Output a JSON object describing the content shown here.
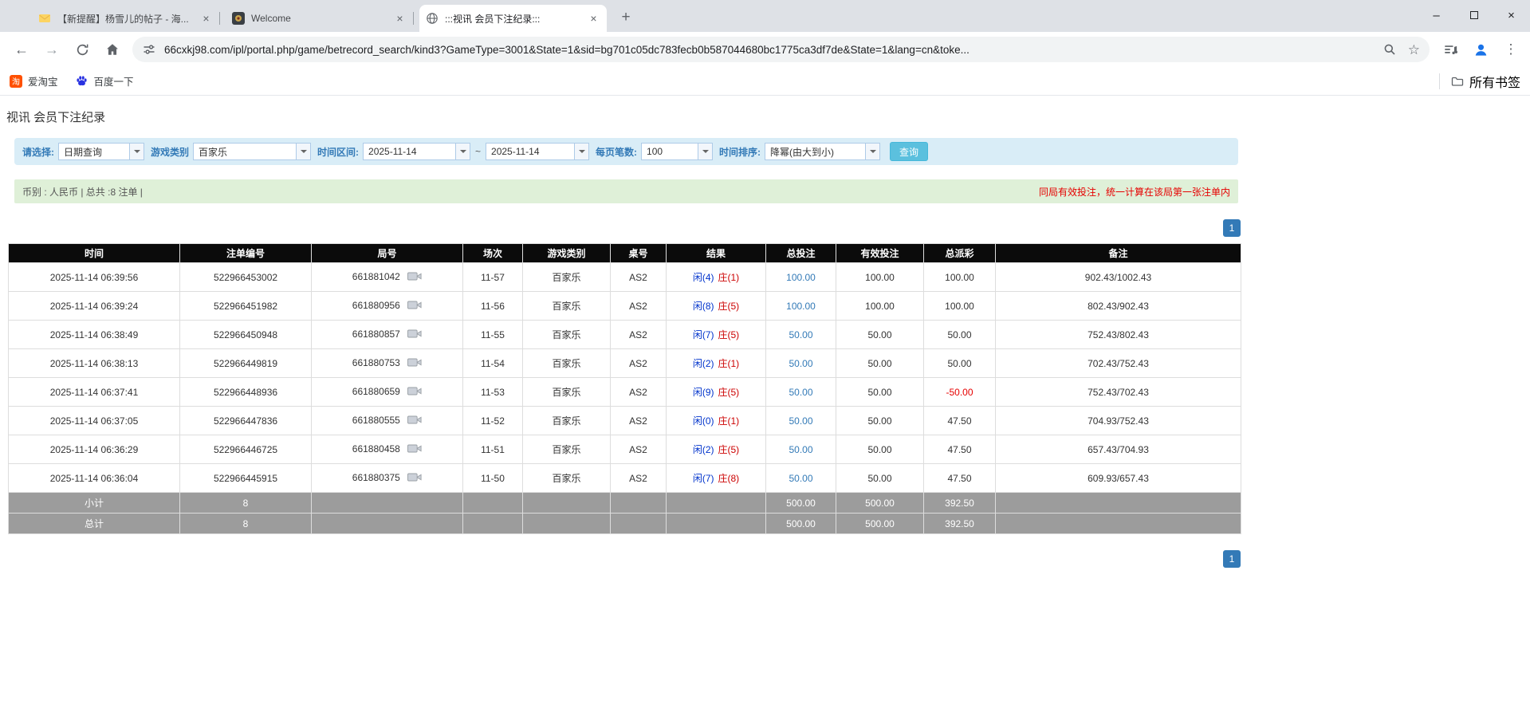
{
  "browser": {
    "tabs": [
      {
        "title": "【新提醒】杨雪儿的帖子 - 海..."
      },
      {
        "title": "Welcome"
      },
      {
        "title": ":::视讯 会员下注纪录:::"
      }
    ],
    "url": "66cxkj98.com/ipl/portal.php/game/betrecord_search/kind3?GameType=3001&State=1&sid=bg701c05dc783fecb0b587044680bc1775ca3df7de&State=1&lang=cn&toke...",
    "glyphs": {
      "back": "←",
      "forward": "→",
      "star": "☆",
      "menu": "⋮",
      "new_tab": "+",
      "close": "×",
      "minimize": "–"
    },
    "bookmarks": {
      "items": [
        {
          "label": "爱淘宝",
          "badge": "淘"
        },
        {
          "label": "百度一下"
        }
      ],
      "all_bookmarks": "所有书签"
    }
  },
  "page": {
    "title": "视讯 会员下注纪录",
    "filters": {
      "select_label": "请选择:",
      "select_value": "日期查询",
      "game_type_label": "游戏类别",
      "game_type_value": "百家乐",
      "range_label": "时间区间:",
      "date_from": "2025-11-14",
      "tilde": "~",
      "date_to": "2025-11-14",
      "per_page_label": "每页笔数:",
      "per_page_value": "100",
      "sort_label": "时间排序:",
      "sort_value": "降幂(由大到小)",
      "search_button": "查询"
    },
    "summary_bar": {
      "left": "币别 : 人民币 | 总共 :8 注单 |",
      "right": "同局有效投注，统一计算在该局第一张注单内"
    },
    "pagination": {
      "page": "1"
    },
    "colors": {
      "accent_blue": "#337ab7",
      "search_button": "#5bc0de",
      "player_blue": "#0033cc",
      "banker_red": "#cc0000",
      "negative_red": "#e60000",
      "filter_bg": "#d9edf7",
      "info_bg": "#dff0d8",
      "header_bg": "#0b0b0b",
      "summary_bg": "#9c9c9c"
    },
    "table": {
      "headers": [
        "时间",
        "注单编号",
        "局号",
        "场次",
        "游戏类别",
        "桌号",
        "结果",
        "总投注",
        "有效投注",
        "总派彩",
        "备注"
      ],
      "rows": [
        {
          "time": "2025-11-14 06:39:56",
          "bet_no": "522966453002",
          "round_no": "661881042",
          "session": "11-57",
          "game": "百家乐",
          "table_no": "AS2",
          "result_player": "闲(4)",
          "result_banker": "庄(1)",
          "total_bet": "100.00",
          "valid_bet": "100.00",
          "payout": "100.00",
          "note": "902.43/1002.43"
        },
        {
          "time": "2025-11-14 06:39:24",
          "bet_no": "522966451982",
          "round_no": "661880956",
          "session": "11-56",
          "game": "百家乐",
          "table_no": "AS2",
          "result_player": "闲(8)",
          "result_banker": "庄(5)",
          "total_bet": "100.00",
          "valid_bet": "100.00",
          "payout": "100.00",
          "note": "802.43/902.43"
        },
        {
          "time": "2025-11-14 06:38:49",
          "bet_no": "522966450948",
          "round_no": "661880857",
          "session": "11-55",
          "game": "百家乐",
          "table_no": "AS2",
          "result_player": "闲(7)",
          "result_banker": "庄(5)",
          "total_bet": "50.00",
          "valid_bet": "50.00",
          "payout": "50.00",
          "note": "752.43/802.43"
        },
        {
          "time": "2025-11-14 06:38:13",
          "bet_no": "522966449819",
          "round_no": "661880753",
          "session": "11-54",
          "game": "百家乐",
          "table_no": "AS2",
          "result_player": "闲(2)",
          "result_banker": "庄(1)",
          "total_bet": "50.00",
          "valid_bet": "50.00",
          "payout": "50.00",
          "note": "702.43/752.43"
        },
        {
          "time": "2025-11-14 06:37:41",
          "bet_no": "522966448936",
          "round_no": "661880659",
          "session": "11-53",
          "game": "百家乐",
          "table_no": "AS2",
          "result_player": "闲(9)",
          "result_banker": "庄(5)",
          "total_bet": "50.00",
          "valid_bet": "50.00",
          "payout": "-50.00",
          "note": "752.43/702.43"
        },
        {
          "time": "2025-11-14 06:37:05",
          "bet_no": "522966447836",
          "round_no": "661880555",
          "session": "11-52",
          "game": "百家乐",
          "table_no": "AS2",
          "result_player": "闲(0)",
          "result_banker": "庄(1)",
          "total_bet": "50.00",
          "valid_bet": "50.00",
          "payout": "47.50",
          "note": "704.93/752.43"
        },
        {
          "time": "2025-11-14 06:36:29",
          "bet_no": "522966446725",
          "round_no": "661880458",
          "session": "11-51",
          "game": "百家乐",
          "table_no": "AS2",
          "result_player": "闲(2)",
          "result_banker": "庄(5)",
          "total_bet": "50.00",
          "valid_bet": "50.00",
          "payout": "47.50",
          "note": "657.43/704.93"
        },
        {
          "time": "2025-11-14 06:36:04",
          "bet_no": "522966445915",
          "round_no": "661880375",
          "session": "11-50",
          "game": "百家乐",
          "table_no": "AS2",
          "result_player": "闲(7)",
          "result_banker": "庄(8)",
          "total_bet": "50.00",
          "valid_bet": "50.00",
          "payout": "47.50",
          "note": "609.93/657.43"
        }
      ],
      "subtotal": {
        "label": "小计",
        "count": "8",
        "total_bet": "500.00",
        "valid_bet": "500.00",
        "payout": "392.50"
      },
      "total": {
        "label": "总计",
        "count": "8",
        "total_bet": "500.00",
        "valid_bet": "500.00",
        "payout": "392.50"
      }
    }
  }
}
